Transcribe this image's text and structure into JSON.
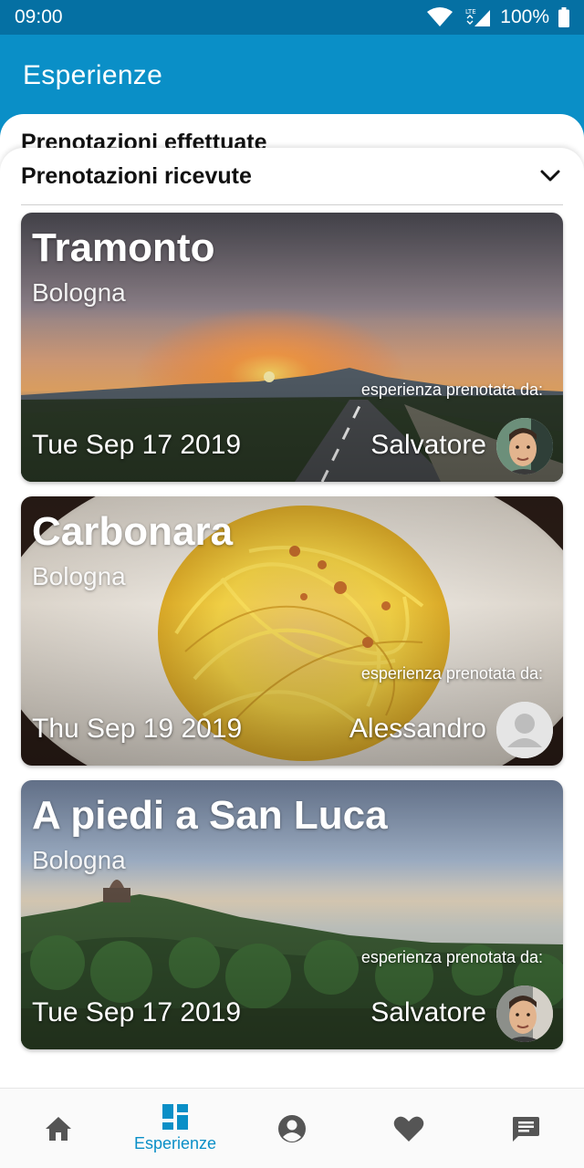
{
  "status_bar": {
    "time": "09:00",
    "battery": "100%",
    "network": "LTE"
  },
  "app_bar": {
    "title": "Esperienze"
  },
  "sections": {
    "made": "Prenotazioni effettuate",
    "received": "Prenotazioni ricevute"
  },
  "booked_by_label": "esperienza prenotata da:",
  "cards": [
    {
      "title": "Tramonto",
      "city": "Bologna",
      "date": "Tue Sep 17 2019",
      "user": "Salvatore",
      "image": "sunset-road-photo",
      "avatar": "photo"
    },
    {
      "title": "Carbonara",
      "city": "Bologna",
      "date": "Thu Sep 19 2019",
      "user": "Alessandro",
      "image": "carbonara-pasta-photo",
      "avatar": "placeholder"
    },
    {
      "title": "A piedi a San Luca",
      "city": "Bologna",
      "date": "Tue Sep 17 2019",
      "user": "Salvatore",
      "image": "san-luca-hills-photo",
      "avatar": "photo"
    }
  ],
  "bottom_nav": [
    {
      "icon": "home-icon"
    },
    {
      "icon": "dashboard-icon",
      "label": "Esperienze",
      "active": true
    },
    {
      "icon": "account-icon"
    },
    {
      "icon": "heart-icon"
    },
    {
      "icon": "chat-icon"
    }
  ],
  "colors": {
    "primary": "#0a8fc7",
    "status_bar": "#0570a3"
  }
}
